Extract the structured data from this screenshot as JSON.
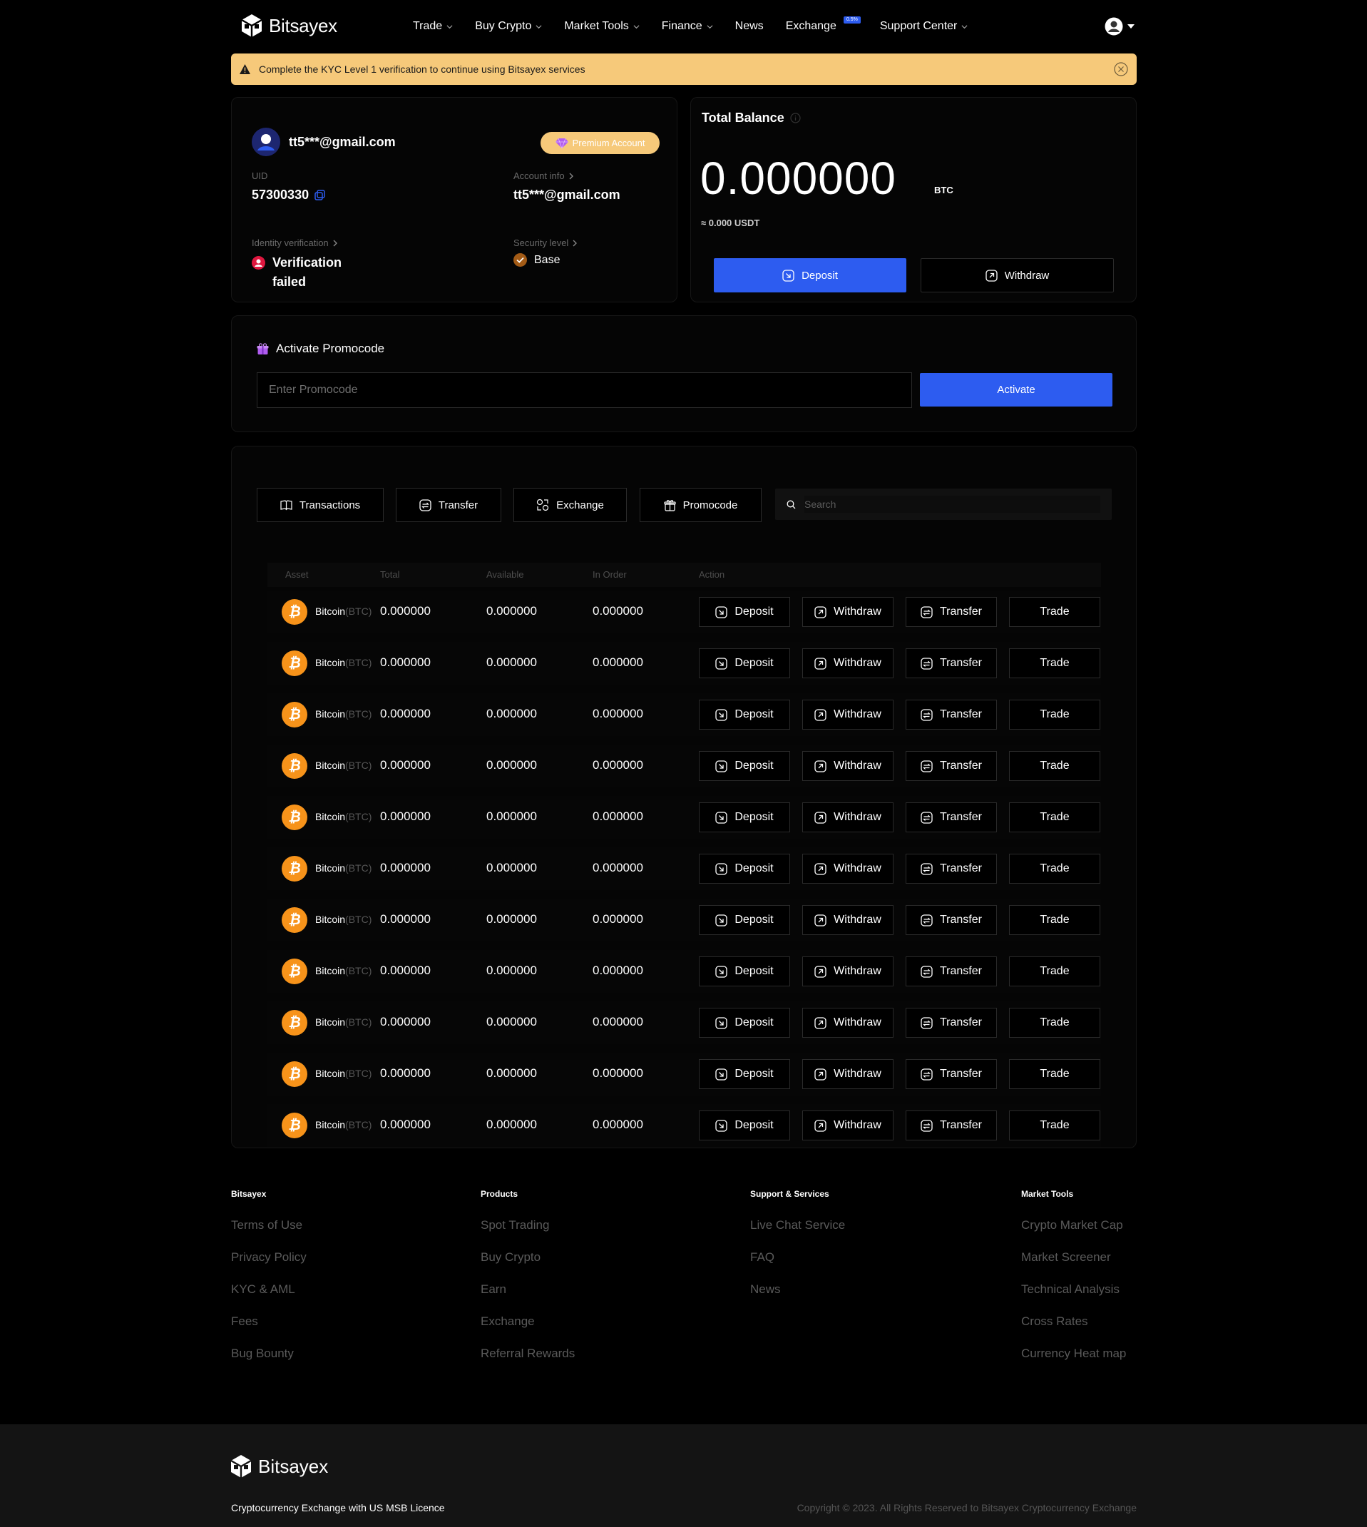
{
  "brand": {
    "name": "Bitsayex"
  },
  "nav": {
    "items": [
      {
        "label": "Trade",
        "dropdown": true
      },
      {
        "label": "Buy Crypto",
        "dropdown": true
      },
      {
        "label": "Market Tools",
        "dropdown": true
      },
      {
        "label": "Finance",
        "dropdown": true
      },
      {
        "label": "News",
        "dropdown": false
      },
      {
        "label": "Exchange",
        "dropdown": false,
        "badge": "0.5%"
      },
      {
        "label": "Support Center",
        "dropdown": true
      }
    ]
  },
  "kyc_banner": {
    "text": "Complete the KYC Level 1 verification to continue using Bitsayex services"
  },
  "account": {
    "email": "tt5***@gmail.com",
    "premium_label": "Premium Account",
    "uid_label": "UID",
    "uid": "57300330",
    "account_info_label": "Account info",
    "account_info_value": "tt5***@gmail.com",
    "identity_label": "Identity verification",
    "identity_line1": "Verification",
    "identity_line2": "failed",
    "security_label": "Security level",
    "security_value": "Base"
  },
  "balance": {
    "title": "Total Balance",
    "amount": "0.000000",
    "unit": "BTC",
    "usdt": "≈ 0.000 USDT",
    "deposit_label": "Deposit",
    "withdraw_label": "Withdraw"
  },
  "promo": {
    "title": "Activate Promocode",
    "placeholder": "Enter Promocode",
    "button": "Activate"
  },
  "tabs": [
    "Transactions",
    "Transfer",
    "Exchange",
    "Promocode"
  ],
  "search": {
    "placeholder": "Search"
  },
  "table": {
    "headers": [
      "Asset",
      "Total",
      "Available",
      "In Order",
      "Action"
    ],
    "actions": [
      "Deposit",
      "Withdraw",
      "Transfer",
      "Trade"
    ],
    "rows": [
      {
        "name": "Bitcoin",
        "symbol": "(BTC)",
        "total": "0.000000",
        "available": "0.000000",
        "in_order": "0.000000"
      },
      {
        "name": "Bitcoin",
        "symbol": "(BTC)",
        "total": "0.000000",
        "available": "0.000000",
        "in_order": "0.000000"
      },
      {
        "name": "Bitcoin",
        "symbol": "(BTC)",
        "total": "0.000000",
        "available": "0.000000",
        "in_order": "0.000000"
      },
      {
        "name": "Bitcoin",
        "symbol": "(BTC)",
        "total": "0.000000",
        "available": "0.000000",
        "in_order": "0.000000"
      },
      {
        "name": "Bitcoin",
        "symbol": "(BTC)",
        "total": "0.000000",
        "available": "0.000000",
        "in_order": "0.000000"
      },
      {
        "name": "Bitcoin",
        "symbol": "(BTC)",
        "total": "0.000000",
        "available": "0.000000",
        "in_order": "0.000000"
      },
      {
        "name": "Bitcoin",
        "symbol": "(BTC)",
        "total": "0.000000",
        "available": "0.000000",
        "in_order": "0.000000"
      },
      {
        "name": "Bitcoin",
        "symbol": "(BTC)",
        "total": "0.000000",
        "available": "0.000000",
        "in_order": "0.000000"
      },
      {
        "name": "Bitcoin",
        "symbol": "(BTC)",
        "total": "0.000000",
        "available": "0.000000",
        "in_order": "0.000000"
      },
      {
        "name": "Bitcoin",
        "symbol": "(BTC)",
        "total": "0.000000",
        "available": "0.000000",
        "in_order": "0.000000"
      },
      {
        "name": "Bitcoin",
        "symbol": "(BTC)",
        "total": "0.000000",
        "available": "0.000000",
        "in_order": "0.000000"
      }
    ]
  },
  "footer": {
    "columns": [
      {
        "title": "Bitsayex",
        "links": [
          "Terms of Use",
          "Privacy Policy",
          "KYC & AML",
          "Fees",
          "Bug Bounty"
        ]
      },
      {
        "title": "Products",
        "links": [
          "Spot Trading",
          "Buy Crypto",
          "Earn",
          "Exchange",
          "Referral Rewards"
        ]
      },
      {
        "title": "Support & Services",
        "links": [
          "Live Chat Service",
          "FAQ",
          "News"
        ]
      },
      {
        "title": "Market Tools",
        "links": [
          "Crypto Market Cap",
          "Market Screener",
          "Technical Analysis",
          "Cross Rates",
          "Currency Heat map"
        ]
      }
    ],
    "licence": "Cryptocurrency Exchange with US MSB Licence",
    "copyright": "Copyright © 2023. All Rights Reserved to Bitsayex Cryptocurrency Exchange"
  },
  "colors": {
    "accent": "#2d5cf0",
    "warning": "#f6c97a",
    "bitcoin": "#f7931a",
    "background": "#000000"
  }
}
